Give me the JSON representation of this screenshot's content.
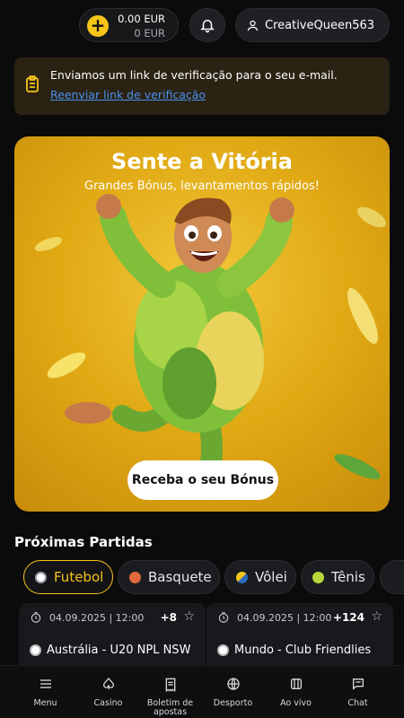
{
  "header": {
    "balance_main": "0.00 EUR",
    "balance_bonus": "0 EUR",
    "add_icon": "plus-icon",
    "bell_icon": "bell-icon",
    "user_icon": "user-icon",
    "username": "CreativeQueen563"
  },
  "notice": {
    "icon": "clipboard-icon",
    "message": "Enviamos um link de verificação para o seu e-mail.",
    "link": "Reenviar link de verificação"
  },
  "banner": {
    "title": "Sente a Vitória",
    "subtitle": "Grandes Bónus, levantamentos rápidos!",
    "cta": "Receba o seu Bónus"
  },
  "upcoming": {
    "title": "Próximas Partidas",
    "chips": [
      {
        "label": "Futebol",
        "icon": "soccer-ball-icon",
        "active": true
      },
      {
        "label": "Basquete",
        "icon": "basketball-icon",
        "active": false
      },
      {
        "label": "Vôlei",
        "icon": "volleyball-icon",
        "active": false
      },
      {
        "label": "Tênis",
        "icon": "tennis-ball-icon",
        "active": false
      }
    ],
    "matches": [
      {
        "date": "04.09.2025 | 12:00",
        "count": "+8",
        "league": "Austrália - U20 NPL NSW"
      },
      {
        "date": "04.09.2025 | 12:00",
        "count": "+124",
        "league": "Mundo - Club Friendlies"
      }
    ]
  },
  "nav": {
    "items": [
      {
        "label": "Menu",
        "icon": "menu-icon"
      },
      {
        "label": "Casino",
        "icon": "casino-icon"
      },
      {
        "label": "Boletim de apostas",
        "icon": "betslip-icon"
      },
      {
        "label": "Desporto",
        "icon": "sports-ball-icon"
      },
      {
        "label": "Ao vivo",
        "icon": "live-icon"
      },
      {
        "label": "Chat",
        "icon": "chat-icon"
      }
    ]
  },
  "colors": {
    "accent": "#f5c518",
    "link": "#4a90f0",
    "background": "#0b0b0c"
  }
}
